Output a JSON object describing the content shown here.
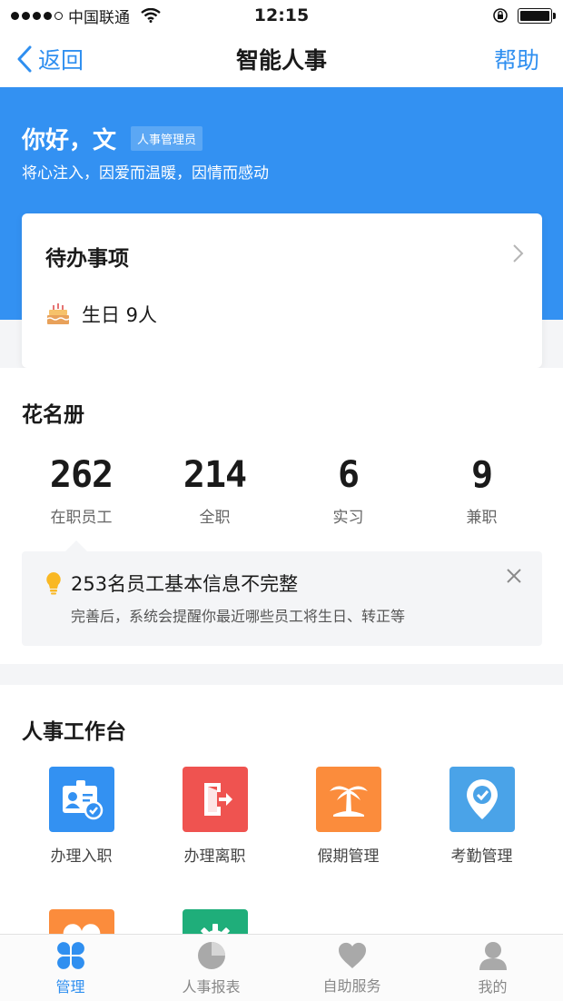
{
  "status_bar": {
    "carrier": "中国联通",
    "time": "12:15",
    "battery_level": 1.0
  },
  "nav": {
    "back_label": "返回",
    "title": "智能人事",
    "help_label": "帮助"
  },
  "hero": {
    "greeting": "你好，文",
    "role": "人事管理员",
    "motto": "将心注入，因爱而温暖，因情而感动",
    "color": "#3391f2"
  },
  "todo": {
    "title": "待办事项",
    "items": [
      {
        "icon": "birthday-cake-icon",
        "label": "生日 9人"
      }
    ]
  },
  "roster": {
    "title": "花名册",
    "stats": [
      {
        "value": "262",
        "label": "在职员工"
      },
      {
        "value": "214",
        "label": "全职"
      },
      {
        "value": "6",
        "label": "实习"
      },
      {
        "value": "9",
        "label": "兼职"
      }
    ],
    "notice": {
      "icon": "lightbulb-icon",
      "title": "253名员工基本信息不完整",
      "description": "完善后，系统会提醒你最近哪些员工将生日、转正等"
    }
  },
  "workbench": {
    "title": "人事工作台",
    "apps": [
      {
        "label": "办理入职",
        "icon": "id-card-check-icon",
        "color": "#3391f2"
      },
      {
        "label": "办理离职",
        "icon": "exit-door-icon",
        "color": "#ef5350"
      },
      {
        "label": "假期管理",
        "icon": "palm-tree-icon",
        "color": "#fb8c3c"
      },
      {
        "label": "考勤管理",
        "icon": "location-check-icon",
        "color": "#4aa3e8"
      },
      {
        "label": "",
        "icon": "heart-icon",
        "color": "#fb8c3c"
      },
      {
        "label": "",
        "icon": "gear-icon",
        "color": "#1fae7a"
      }
    ]
  },
  "tabs": [
    {
      "label": "管理",
      "icon": "clover-grid-icon",
      "active": true
    },
    {
      "label": "人事报表",
      "icon": "pie-chart-icon",
      "active": false
    },
    {
      "label": "自助服务",
      "icon": "heart-icon",
      "active": false
    },
    {
      "label": "我的",
      "icon": "user-icon",
      "active": false
    }
  ],
  "colors": {
    "accent": "#2f8ff0",
    "inactive_tab": "#a9a9a9"
  }
}
